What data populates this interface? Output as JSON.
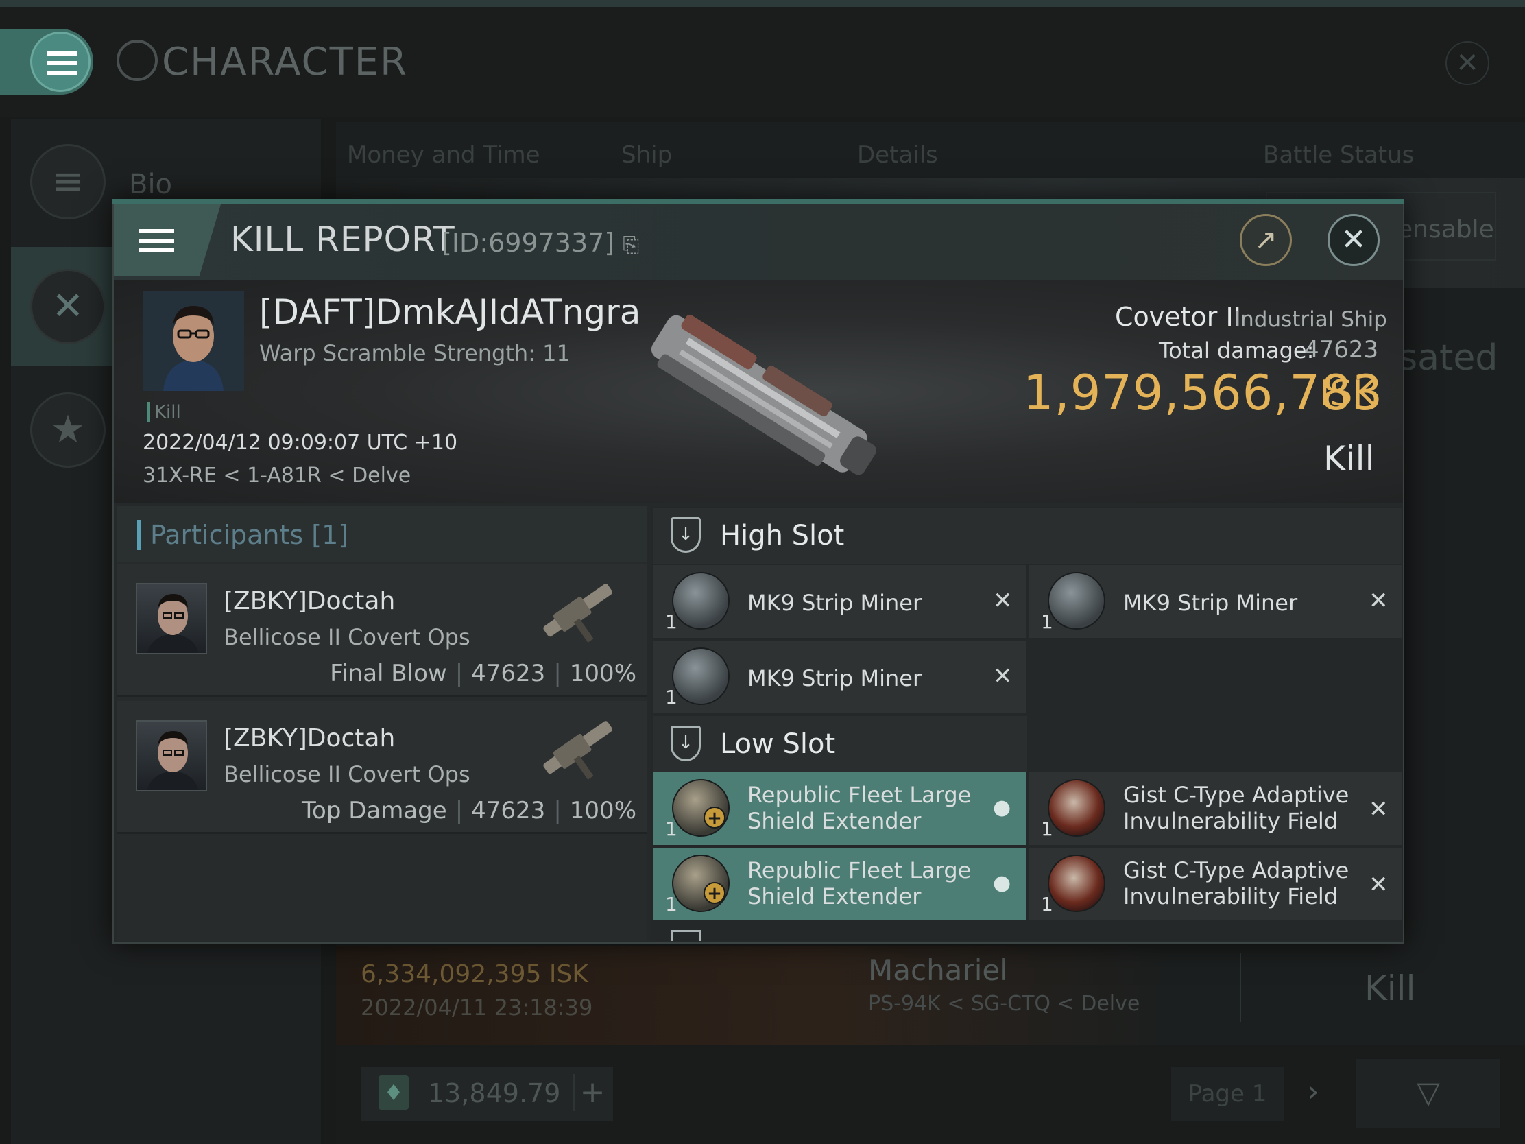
{
  "app": {
    "title": "CHARACTER",
    "sidebar": {
      "bio_label": "Bio"
    }
  },
  "background": {
    "tabs": [
      "Money and Time",
      "Ship",
      "Details",
      "Battle Status"
    ],
    "dispensable_fragment": "ensable",
    "compensated_fragment": "sated",
    "kill_row": {
      "isk": "6,334,092,395  ISK",
      "date": "2022/04/11  23:18:39",
      "ship": "Machariel",
      "location": "PS-94K < SG-CTQ < Delve",
      "status": "Kill"
    },
    "wallet": {
      "value": "13,849.79",
      "plus": "+"
    },
    "pagination": {
      "page_label": "Page 1",
      "next": "›"
    }
  },
  "kill_report": {
    "title": "KILL REPORT",
    "id": "[ID:6997337]",
    "victim": {
      "name": "[DAFT]DmkAJIdATngra",
      "warp_scramble": "Warp Scramble Strength: 11",
      "tag": "Kill",
      "datetime": "2022/04/12 09:09:07 UTC +10",
      "location": "31X-RE < 1-A81R < Delve"
    },
    "ship": {
      "name": "Covetor II",
      "class": "Industrial Ship",
      "total_damage_label": "Total damage:",
      "total_damage": "47623",
      "isk_value": "1,979,566,783",
      "isk_unit": "ISK",
      "status": "Kill"
    },
    "participants": {
      "title": "Participants [1]",
      "rows": [
        {
          "name": "[ZBKY]Doctah",
          "ship": "Bellicose II Covert Ops",
          "role": "Final Blow",
          "damage": "47623",
          "percent": "100%"
        },
        {
          "name": "[ZBKY]Doctah",
          "ship": "Bellicose II Covert Ops",
          "role": "Top Damage",
          "damage": "47623",
          "percent": "100%"
        }
      ]
    },
    "fitting": {
      "high_slot_title": "High Slot",
      "low_slot_title": "Low Slot",
      "high_slot": [
        {
          "qty": "1",
          "name": "MK9 Strip Miner"
        },
        {
          "qty": "1",
          "name": "MK9 Strip Miner"
        },
        {
          "qty": "1",
          "name": "MK9 Strip Miner"
        }
      ],
      "low_slot": [
        {
          "qty": "1",
          "name": "Republic Fleet Large Shield Extender"
        },
        {
          "qty": "1",
          "name": "Gist C-Type Adaptive Invulnerability Field"
        },
        {
          "qty": "1",
          "name": "Republic Fleet Large Shield Extender"
        },
        {
          "qty": "1",
          "name": "Gist C-Type Adaptive Invulnerability Field"
        }
      ]
    }
  },
  "colors": {
    "accent": "#3d6e66",
    "isk_gold": "#e4b358",
    "fitted_module": "#4d7e76",
    "participants_title": "#5d7f8c"
  },
  "icons": [
    "menu-icon",
    "character-logo-icon",
    "close-icon",
    "bio-icon",
    "combat-icon",
    "star-icon",
    "copy-icon",
    "export-icon",
    "slot-icon",
    "person-icon",
    "plus-icon",
    "filter-icon",
    "wallet-icon"
  ]
}
